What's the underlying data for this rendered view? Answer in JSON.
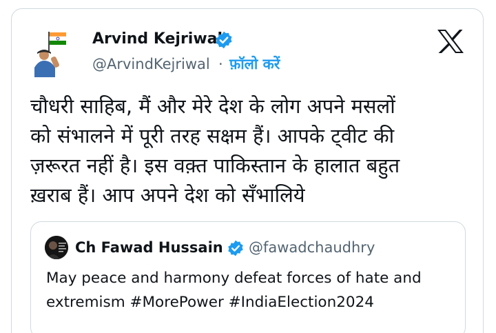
{
  "tweet": {
    "author": {
      "name": "Arvind Kejriwal",
      "handle": "@ArvindKejriwal",
      "separator": "·",
      "follow_label": "फ़ॉलो करें",
      "verified_icon": "verified-badge-icon"
    },
    "platform_logo": "x-logo-icon",
    "text_lines": [
      "चौधरी साहिब, मैं और मेरे देश के लोग अपने मसलों",
      "को संभालने में पूरी तरह सक्षम हैं। आपके ट्वीट की",
      "ज़रूरत नहीं है। इस वक़्त पाकिस्तान के हालात बहुत",
      "ख़राब हैं। आप अपने देश को सँभालिये"
    ],
    "quoted": {
      "name": "Ch Fawad Hussain",
      "handle": "@fawadchaudhry",
      "text_lines": [
        "May peace and harmony defeat forces of hate and",
        "extremism #MorePower #IndiaElection2024"
      ]
    }
  },
  "colors": {
    "text": "#0f1419",
    "secondary": "#536471",
    "accent": "#1d9bf0",
    "border": "#cfd9de"
  }
}
